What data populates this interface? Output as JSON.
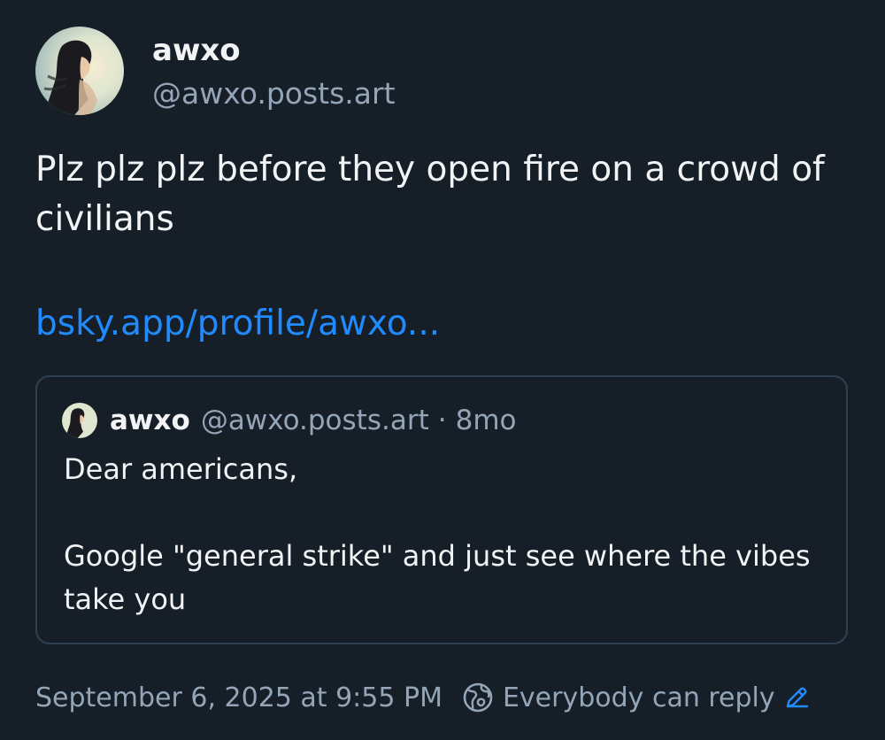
{
  "author": {
    "display_name": "awxo",
    "handle": "@awxo.posts.art",
    "avatar_icon": "avatar-portrait"
  },
  "post": {
    "text": "Plz plz plz before they open fire on a crowd of civilians",
    "link": "bsky.app/profile/awxo..."
  },
  "quote": {
    "display_name": "awxo",
    "handle": "@awxo.posts.art",
    "separator": "·",
    "time_ago": "8mo",
    "text": "Dear americans,\n\nGoogle \"general strike\" and just see where the vibes take you"
  },
  "footer": {
    "timestamp": "September 6, 2025 at 9:55 PM",
    "reply_setting": "Everybody can reply",
    "reply_icon": "globe-icon",
    "edit_icon": "pencil-icon"
  },
  "colors": {
    "background": "#161e27",
    "text": "#f1f3f5",
    "muted": "#93a5b7",
    "link": "#208bfe",
    "card_border": "#2e4052"
  }
}
